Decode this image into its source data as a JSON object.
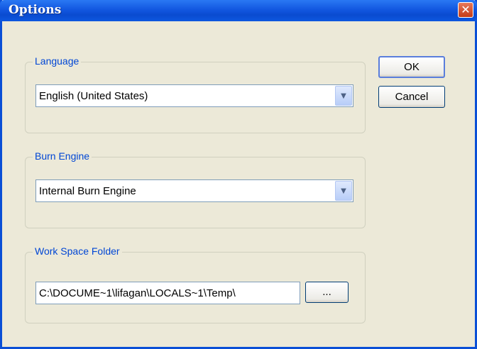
{
  "window": {
    "title": "Options",
    "close_glyph": "✕"
  },
  "language": {
    "legend": "Language",
    "selected": "English (United States)"
  },
  "burn_engine": {
    "legend": "Burn Engine",
    "selected": "Internal Burn Engine"
  },
  "workspace": {
    "legend": "Work Space Folder",
    "path": "C:\\DOCUME~1\\lifagan\\LOCALS~1\\Temp\\",
    "browse_label": "..."
  },
  "buttons": {
    "ok": "OK",
    "cancel": "Cancel"
  },
  "icons": {
    "close": "close-icon",
    "dropdown": "chevron-down-icon"
  },
  "colors": {
    "titlebar": "#0a4bd0",
    "group_label": "#0046d5",
    "window_bg": "#ece9d8",
    "close_button": "#d9532e"
  }
}
